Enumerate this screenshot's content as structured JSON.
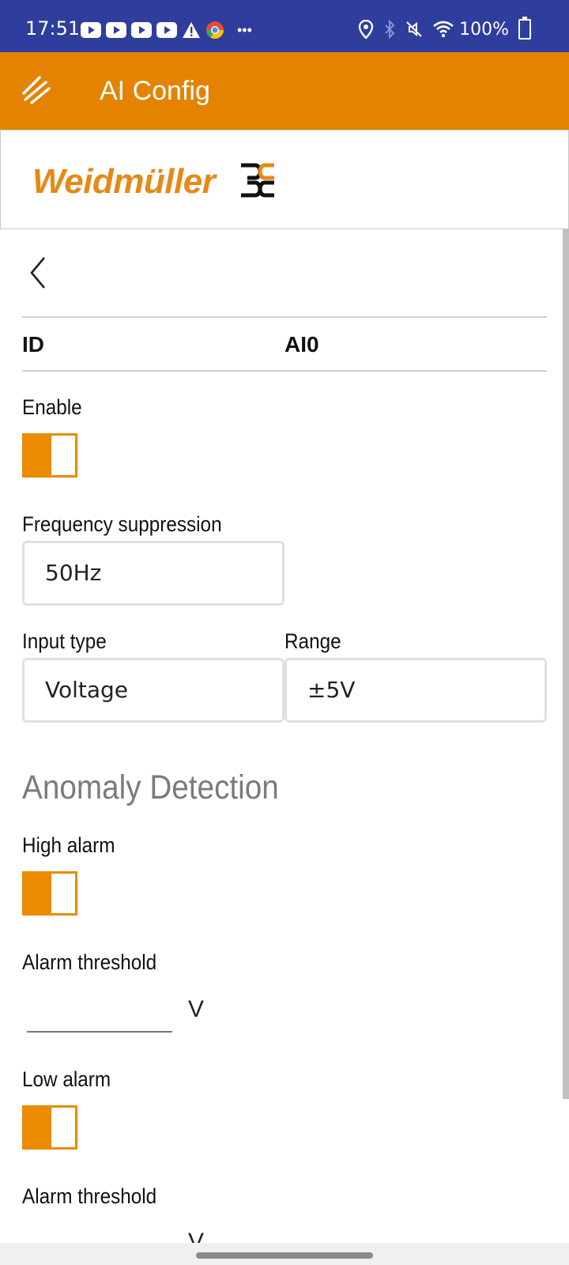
{
  "status_bar": {
    "time": "17:51",
    "notification_icons": [
      "youtube-icon",
      "youtube-icon",
      "youtube-icon",
      "youtube-icon",
      "warning-icon",
      "chrome-icon",
      "more-icon"
    ],
    "system_icons": [
      "location-icon",
      "bluetooth-icon",
      "mute-icon",
      "wifi-icon",
      "battery-icon"
    ],
    "battery": "100%"
  },
  "app_bar": {
    "title": "AI Config",
    "color": "#e38300"
  },
  "logo": {
    "text": "Weidmüller"
  },
  "header_row": {
    "id_label": "ID",
    "id_value": "AI0"
  },
  "form": {
    "enable_label": "Enable",
    "enable_on": true,
    "frequency_label": "Frequency suppression",
    "frequency_value": "50Hz",
    "input_type_label": "Input type",
    "input_type_value": "Voltage",
    "range_label": "Range",
    "range_value": "±5V"
  },
  "anomaly": {
    "section_title": "Anomaly Detection",
    "high_alarm_label": "High alarm",
    "high_alarm_on": true,
    "high_threshold_label": "Alarm threshold",
    "high_threshold_value": "",
    "high_unit": "V",
    "low_alarm_label": "Low alarm",
    "low_alarm_on": true,
    "low_threshold_label": "Alarm threshold",
    "low_unit": "V"
  },
  "colors": {
    "status_bar": "#2f3d9d",
    "accent": "#ec8a00",
    "logo_orange": "#e58a16"
  }
}
